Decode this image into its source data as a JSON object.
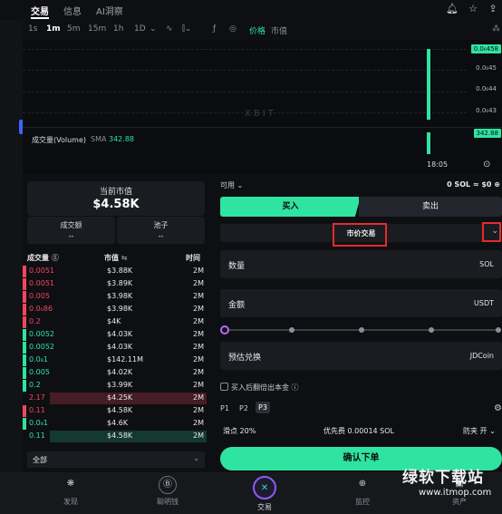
{
  "tabs": [
    "交易",
    "信息",
    "AI洞察"
  ],
  "toolbar": {
    "timeframes": [
      "1s",
      "1m",
      "5m",
      "15m",
      "1h",
      "1D"
    ],
    "active_timeframe": "1m",
    "tools": [
      "chevron-down-icon",
      "wave-icon",
      "candles-icon",
      "indicator-icon",
      "settings-icon"
    ],
    "price_toggle": "价格",
    "market_cap_toggle": "市值"
  },
  "chart": {
    "y_labels": [
      "0.0₆45",
      "0.0₆44",
      "0.0₆43"
    ],
    "price_tag": "0.0₆458",
    "volume_tag": "342.88",
    "volume_label": "成交量(Volume)",
    "sma_label": "SMA",
    "sma_value": "342.88",
    "time_label": "18:05",
    "watermark": "XBIT"
  },
  "stats": {
    "market_cap_label": "当前市值",
    "market_cap_value": "$4.58K",
    "volume_label": "成交额",
    "volume_value": "--",
    "pool_label": "池子",
    "pool_value": "--"
  },
  "trades": {
    "headers": [
      "成交量",
      "市值",
      "时间"
    ],
    "rows": [
      {
        "amount": "0.0051",
        "mcap": "$3.88K",
        "time": "2M",
        "side": "sell"
      },
      {
        "amount": "0.0051",
        "mcap": "$3.89K",
        "time": "2M",
        "side": "sell"
      },
      {
        "amount": "0.005",
        "mcap": "$3.98K",
        "time": "2M",
        "side": "sell"
      },
      {
        "amount": "0.0₆86",
        "mcap": "$3.98K",
        "time": "2M",
        "side": "sell"
      },
      {
        "amount": "0.2",
        "mcap": "$4K",
        "time": "2M",
        "side": "sell"
      },
      {
        "amount": "0.0052",
        "mcap": "$4.03K",
        "time": "2M",
        "side": "buy"
      },
      {
        "amount": "0.0052",
        "mcap": "$4.03K",
        "time": "2M",
        "side": "buy"
      },
      {
        "amount": "0.0₈1",
        "mcap": "$142.11M",
        "time": "2M",
        "side": "buy"
      },
      {
        "amount": "0.005",
        "mcap": "$4.02K",
        "time": "2M",
        "side": "buy"
      },
      {
        "amount": "0.2",
        "mcap": "$3.99K",
        "time": "2M",
        "side": "buy"
      },
      {
        "amount": "2.17",
        "mcap": "$4.25K",
        "time": "2M",
        "side": "sell"
      },
      {
        "amount": "0.11",
        "mcap": "$4.58K",
        "time": "2M",
        "side": "sell"
      },
      {
        "amount": "0.0₈1",
        "mcap": "$4.6K",
        "time": "2M",
        "side": "buy"
      },
      {
        "amount": "0.11",
        "mcap": "$4.58K",
        "time": "2M",
        "side": "buy"
      }
    ],
    "filter_label": "全部"
  },
  "order": {
    "available_label": "可用",
    "balance": "0 SOL ≈ $0",
    "buy_label": "买入",
    "sell_label": "卖出",
    "order_type": "市价交易",
    "amount_label": "数量",
    "amount_unit": "SOL",
    "total_label": "金额",
    "total_unit": "USDT",
    "estimate_label": "预估兑换",
    "estimate_unit": "JDCoin",
    "checkbox_label": "买入后翻倍出本金",
    "presets": [
      "P1",
      "P2",
      "P3"
    ],
    "active_preset": "P3",
    "slippage": "滑点 20%",
    "priority_fee": "优先费 0.00014 SOL",
    "mev_protect": "防夹 开",
    "confirm_label": "确认下单"
  },
  "nav": [
    {
      "label": "发现",
      "icon": "discover-icon"
    },
    {
      "label": "聪明钱",
      "icon": "smart-money-icon"
    },
    {
      "label": "交易",
      "icon": "trade-icon"
    },
    {
      "label": "监控",
      "icon": "monitor-icon"
    },
    {
      "label": "资产",
      "icon": "assets-icon"
    }
  ],
  "overlay_watermark": {
    "site_name": "绿软下载站",
    "site_url": "www.itmop.com"
  },
  "colors": {
    "accent": "#2fe3a0",
    "sell": "#f0475e",
    "background": "#0e0f12",
    "highlight": "#e52b2b"
  }
}
